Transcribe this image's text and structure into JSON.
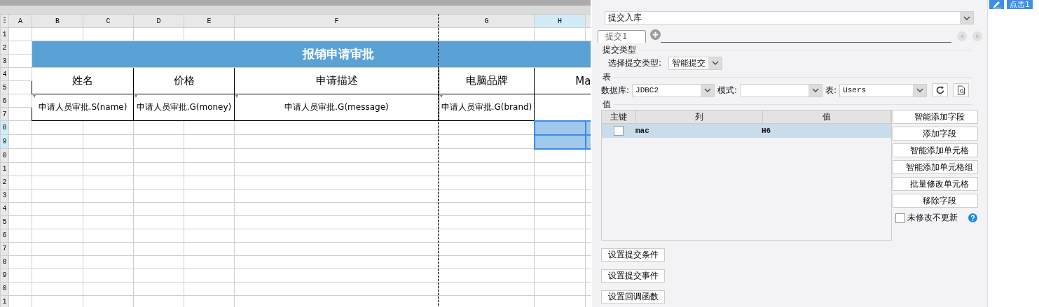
{
  "sheet": {
    "columns": [
      {
        "label": "A",
        "selected": false
      },
      {
        "label": "B",
        "selected": false
      },
      {
        "label": "C",
        "selected": false
      },
      {
        "label": "D",
        "selected": false
      },
      {
        "label": "E",
        "selected": false
      },
      {
        "label": "F",
        "selected": false
      },
      {
        "label": "G",
        "selected": false
      },
      {
        "label": "H",
        "selected": true
      }
    ],
    "rows": [
      {
        "label": "1",
        "selected": false
      },
      {
        "label": "2",
        "selected": false
      },
      {
        "label": "3",
        "selected": false
      },
      {
        "label": "4",
        "selected": false
      },
      {
        "label": "5",
        "selected": false
      },
      {
        "label": "6",
        "selected": false
      },
      {
        "label": "7",
        "selected": false
      },
      {
        "label": "8",
        "selected": true
      },
      {
        "label": "9",
        "selected": true
      },
      {
        "label": "0",
        "selected": false
      },
      {
        "label": "1",
        "selected": false
      },
      {
        "label": "2",
        "selected": false
      },
      {
        "label": "3",
        "selected": false
      },
      {
        "label": "4",
        "selected": false
      },
      {
        "label": "5",
        "selected": false
      },
      {
        "label": "6",
        "selected": false
      },
      {
        "label": "7",
        "selected": false
      },
      {
        "label": "8",
        "selected": false
      },
      {
        "label": "9",
        "selected": false
      },
      {
        "label": "0",
        "selected": false
      },
      {
        "label": "1",
        "selected": false
      }
    ],
    "title": "报销申请审批",
    "headers": [
      "姓名",
      "价格",
      "申请描述",
      "电脑品牌",
      "Ma"
    ],
    "fields": [
      "申请人员审批.S(name)",
      "申请人员审批.G(money)",
      "申请人员审批.G(message)",
      "申请人员审批.G(brand)"
    ]
  },
  "panel": {
    "action": "提交入库",
    "tabs": [
      {
        "label": "提交1",
        "selected": true
      }
    ],
    "submit_type": {
      "section": "提交类型",
      "label": "选择提交类型:",
      "value": "智能提交"
    },
    "table": {
      "section": "表",
      "db_label": "数据库:",
      "db": "JDBC2",
      "schema_label": "模式:",
      "table_label": "表:",
      "table": "Users"
    },
    "values": {
      "section": "值",
      "columns": [
        "主键",
        "列",
        "值"
      ],
      "rows": [
        {
          "key": false,
          "column": "mac",
          "value": "H6",
          "selected": true
        }
      ]
    },
    "side_buttons": [
      "智能添加字段",
      "添加字段",
      "智能添加单元格",
      "智能添加单元格组",
      "批量修改单元格",
      "移除字段"
    ],
    "unchanged_option": {
      "label": "未修改不更新",
      "checked": false
    },
    "bottom_buttons": [
      "设置提交条件",
      "设置提交事件",
      "设置回调函数"
    ]
  },
  "corner": {
    "label": "点击1"
  }
}
